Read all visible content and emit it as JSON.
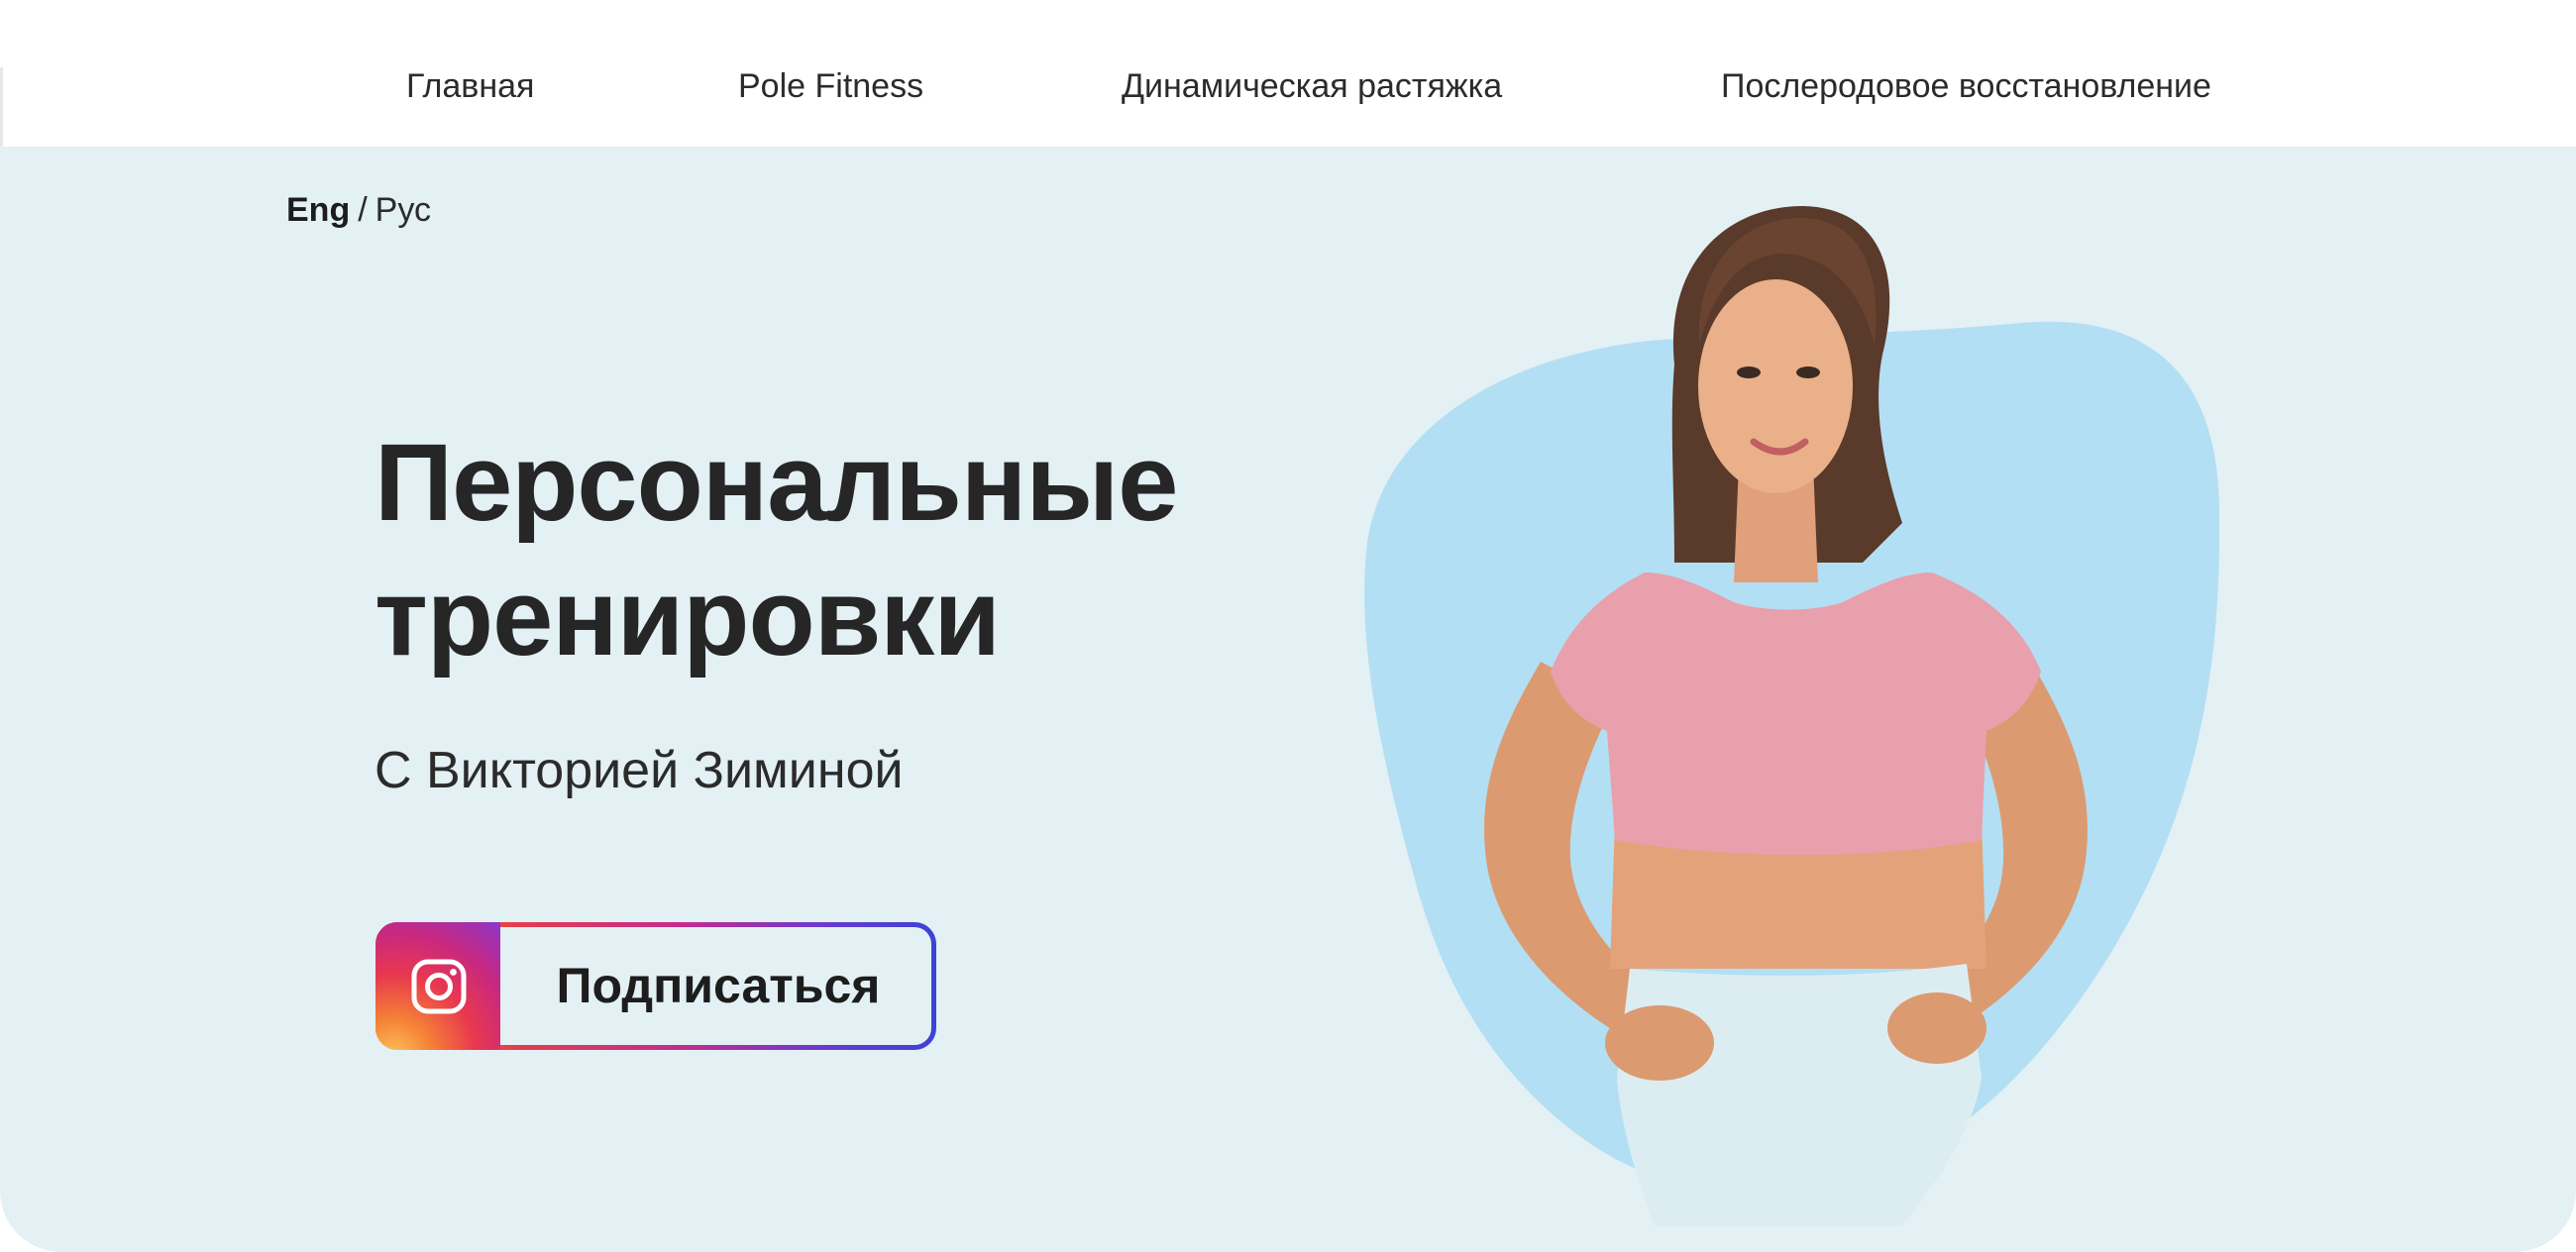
{
  "nav": {
    "items": [
      {
        "label": "Главная"
      },
      {
        "label": "Pole Fitness"
      },
      {
        "label": "Динамическая растяжка"
      },
      {
        "label": "Послеродовое восстановление"
      }
    ]
  },
  "lang": {
    "active": "Eng",
    "separator": "/",
    "inactive": "Рус"
  },
  "hero": {
    "title_line1": "Персональные",
    "title_line2": "тренировки",
    "subtitle": "С Викторией Зиминой",
    "subscribe_label": "Подписаться",
    "subscribe_icon": "instagram-icon",
    "photo_icon": "trainer-photo"
  },
  "colors": {
    "hero_bg": "#e3f0f4",
    "blob": "#b3dff4",
    "text": "#262626",
    "instagram_gradient": [
      "#f0852e",
      "#e33d4d",
      "#c32c8f",
      "#6a3ad0",
      "#3b44d4"
    ]
  }
}
